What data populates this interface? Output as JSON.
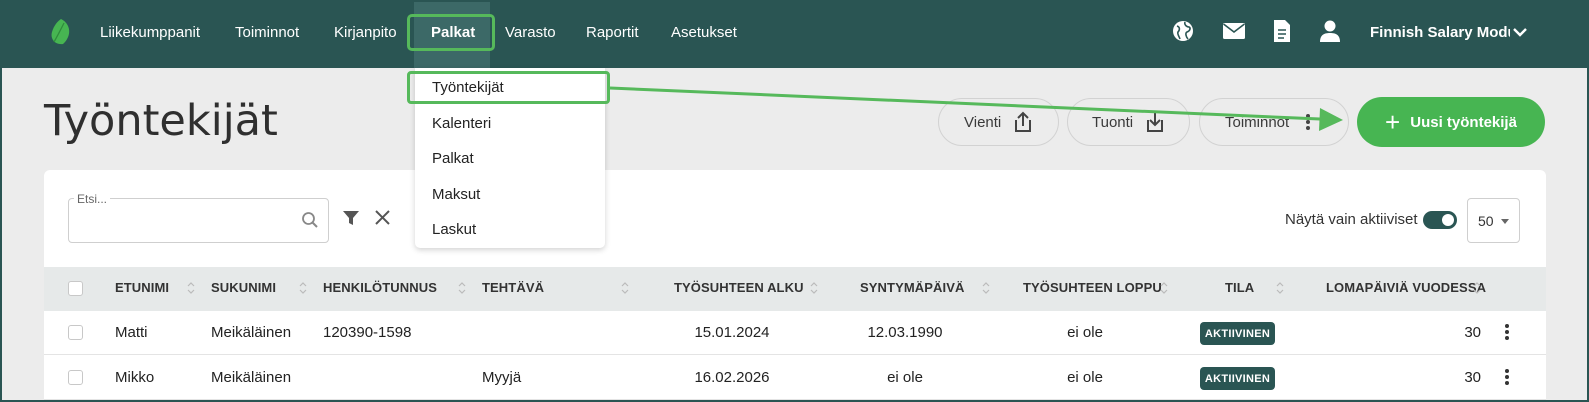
{
  "topbar": {
    "nav": [
      {
        "label": "Liikekumppanit",
        "active": false
      },
      {
        "label": "Toiminnot",
        "active": false
      },
      {
        "label": "Kirjanpito",
        "active": false
      },
      {
        "label": "Palkat",
        "active": true
      },
      {
        "label": "Varasto",
        "active": false
      },
      {
        "label": "Raportit",
        "active": false
      },
      {
        "label": "Asetukset",
        "active": false
      }
    ],
    "icons": [
      "globe-icon",
      "mail-icon",
      "document-icon",
      "user-icon"
    ],
    "company": "Finnish Salary Module",
    "colors": {
      "bar": "#2a5553",
      "accent": "#47b552",
      "highlight": "#56b95b"
    }
  },
  "dropdown": {
    "items": [
      "Työntekijät",
      "Kalenteri",
      "Palkat",
      "Maksut",
      "Laskut"
    ],
    "highlighted": "Työntekijät"
  },
  "page": {
    "title": "Työntekijät",
    "buttons": {
      "export": "Vienti",
      "import": "Tuonti",
      "actions": "Toiminnot",
      "new": "Uusi työntekijä"
    }
  },
  "filters": {
    "search_label": "Etsi...",
    "search_value": "",
    "active_only_label": "Näytä vain aktiiviset",
    "active_only": true,
    "per_page": "50"
  },
  "table": {
    "headers": {
      "first_name": "ETUNIMI",
      "last_name": "SUKUNIMI",
      "ssn": "HENKILÖTUNNUS",
      "task": "TEHTÄVÄ",
      "start": "TYÖSUHTEEN ALKU",
      "birthday": "SYNTYMÄPÄIVÄ",
      "end": "TYÖSUHTEEN LOPPU",
      "status": "TILA",
      "vacation": "LOMAPÄIVIÄ VUODESSA"
    },
    "rows": [
      {
        "first_name": "Matti",
        "last_name": "Meikäläinen",
        "ssn": "120390-1598",
        "task": "",
        "start": "15.01.2024",
        "birthday": "12.03.1990",
        "end": "ei ole",
        "status": "AKTIIVINEN",
        "vacation": "30"
      },
      {
        "first_name": "Mikko",
        "last_name": "Meikäläinen",
        "ssn": "",
        "task": "Myyjä",
        "start": "16.02.2026",
        "birthday": "ei ole",
        "end": "ei ole",
        "status": "AKTIIVINEN",
        "vacation": "30"
      }
    ]
  }
}
